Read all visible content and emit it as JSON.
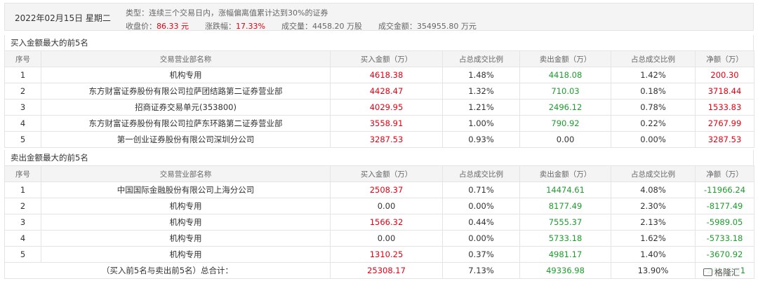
{
  "header": {
    "date": "2022年02月15日 星期二",
    "type_label": "类型：",
    "type_value": "连续三个交易日内，涨幅偏离值累计达到30%的证券",
    "close_label": "收盘价：",
    "close_value": "86.33 元",
    "change_label": "涨跌幅：",
    "change_value": "17.33%",
    "volume_label": "成交量：",
    "volume_value": "4458.20 万股",
    "amount_label": "成交金额：",
    "amount_value": "354955.80 万元"
  },
  "columns": [
    "序号",
    "交易营业部名称",
    "买入金额（万）",
    "占总成交比例",
    "卖出金额（万）",
    "占总成交比例",
    "净额（万）"
  ],
  "buy_section": {
    "title": "买入金额最大的前5名",
    "rows": [
      [
        "1",
        "机构专用",
        "4618.38",
        "1.48%",
        "4418.08",
        "1.42%",
        "200.30"
      ],
      [
        "2",
        "东方财富证券股份有限公司拉萨团结路第二证券营业部",
        "4428.47",
        "1.32%",
        "710.03",
        "0.18%",
        "3718.44"
      ],
      [
        "3",
        "招商证券交易单元(353800)",
        "4029.95",
        "1.21%",
        "2496.12",
        "0.78%",
        "1533.83"
      ],
      [
        "4",
        "东方财富证券股份有限公司拉萨东环路第二证券营业部",
        "3558.91",
        "1.00%",
        "790.92",
        "0.22%",
        "2767.99"
      ],
      [
        "5",
        "第一创业证券股份有限公司深圳分公司",
        "3287.53",
        "0.93%",
        "0.00",
        "0.00%",
        "3287.53"
      ]
    ]
  },
  "sell_section": {
    "title": "卖出金额最大的前5名",
    "rows": [
      [
        "1",
        "中国国际金融股份有限公司上海分公司",
        "2508.37",
        "0.71%",
        "14474.61",
        "4.08%",
        "-11966.24"
      ],
      [
        "2",
        "机构专用",
        "0.00",
        "0.00%",
        "8177.49",
        "2.30%",
        "-8177.49"
      ],
      [
        "3",
        "机构专用",
        "1566.32",
        "0.44%",
        "7555.37",
        "2.13%",
        "-5989.05"
      ],
      [
        "4",
        "机构专用",
        "0.00",
        "0.00%",
        "5733.18",
        "1.62%",
        "-5733.18"
      ],
      [
        "5",
        "机构专用",
        "1310.25",
        "0.37%",
        "4981.17",
        "1.40%",
        "-3670.92"
      ]
    ]
  },
  "total": {
    "label": "（买入前5名与卖出前5名）总合计：",
    "buy": "25308.17",
    "buy_ratio": "7.13%",
    "sell": "49336.98",
    "sell_ratio": "13.90%",
    "net": "-24028.81"
  },
  "watermark": "格隆汇",
  "colors": {
    "positive": "#e60012",
    "negative": "#1c9e2c"
  }
}
